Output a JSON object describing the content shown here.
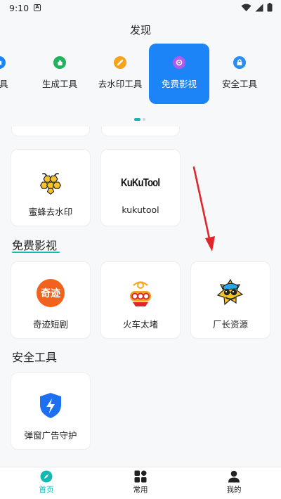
{
  "status": {
    "time": "9:10",
    "a_glyph": "A"
  },
  "page": {
    "title": "发现"
  },
  "categories": [
    {
      "label": "工具",
      "icon": "tool-icon",
      "color": "#1c84f7"
    },
    {
      "label": "生成工具",
      "icon": "generate-icon",
      "color": "#20b25c"
    },
    {
      "label": "去水印工具",
      "icon": "watermark-icon",
      "color": "#f6a21a"
    },
    {
      "label": "免费影视",
      "icon": "film-icon",
      "color": "#b05af0"
    },
    {
      "label": "安全工具",
      "icon": "security-icon",
      "color": "#2a8cf5"
    }
  ],
  "watermark_cards": [
    {
      "label": "蜜蜂去水印",
      "icon": "bee-icon"
    },
    {
      "label": "kukutool",
      "icon": "kukutool-logo",
      "logo_text": "KuKuTool"
    }
  ],
  "sections": {
    "film": {
      "title": "免费影视",
      "cards": [
        {
          "label": "奇迹短剧",
          "icon": "qiji-logo",
          "logo_text": "奇迹"
        },
        {
          "label": "火车太堵",
          "icon": "train-icon"
        },
        {
          "label": "厂长资源",
          "icon": "factory-icon"
        }
      ]
    },
    "security": {
      "title": "安全工具",
      "cards": [
        {
          "label": "弹窗广告守护",
          "icon": "shield-icon"
        }
      ]
    }
  },
  "tabbar": [
    {
      "label": "首页",
      "icon": "compass-icon",
      "active": true
    },
    {
      "label": "常用",
      "icon": "apps-icon",
      "active": false
    },
    {
      "label": "我的",
      "icon": "user-icon",
      "active": false
    }
  ],
  "colors": {
    "accent": "#14b8b0",
    "active_tile": "#1c84f7",
    "arrow": "#e0262a"
  }
}
